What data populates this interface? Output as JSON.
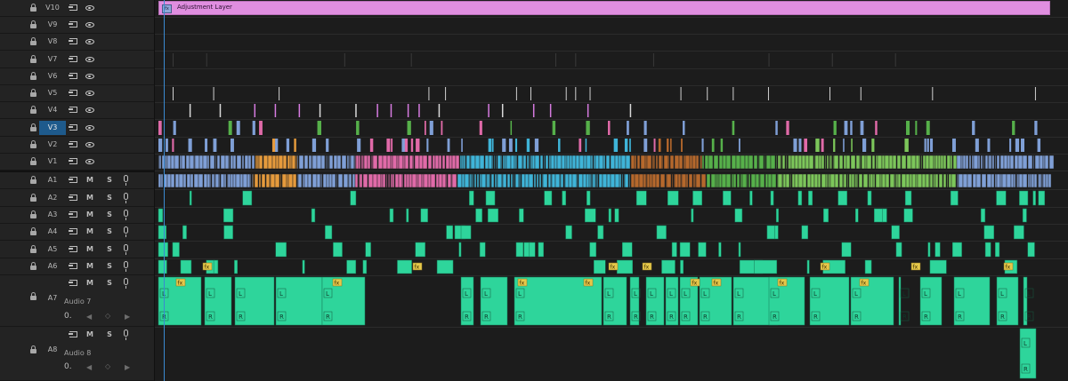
{
  "tracks": {
    "video": [
      {
        "name": "V10",
        "active": false
      },
      {
        "name": "V9",
        "active": false
      },
      {
        "name": "V8",
        "active": false
      },
      {
        "name": "V7",
        "active": false
      },
      {
        "name": "V6",
        "active": false
      },
      {
        "name": "V5",
        "active": false
      },
      {
        "name": "V4",
        "active": false
      },
      {
        "name": "V3",
        "active": true
      },
      {
        "name": "V2",
        "active": false
      },
      {
        "name": "V1",
        "active": false
      }
    ],
    "audio": [
      {
        "name": "A1",
        "m": "M",
        "s": "S"
      },
      {
        "name": "A2",
        "m": "M",
        "s": "S"
      },
      {
        "name": "A3",
        "m": "M",
        "s": "S"
      },
      {
        "name": "A4",
        "m": "M",
        "s": "S"
      },
      {
        "name": "A5",
        "m": "M",
        "s": "S"
      },
      {
        "name": "A6",
        "m": "M",
        "s": "S"
      },
      {
        "name": "A7",
        "m": "M",
        "s": "S",
        "label": "Audio 7",
        "volume": "0."
      },
      {
        "name": "A8",
        "m": "M",
        "s": "S",
        "label": "Audio 8",
        "volume": "0."
      }
    ]
  },
  "adjustment_layer": {
    "label": "Adjustment Layer",
    "fx": "fx"
  },
  "fx_badge": "fx",
  "channel_left": "L",
  "channel_right": "R",
  "colors": {
    "adjustment": "#e08ee0",
    "v1_blue": "#7f9fd6",
    "orange": "#e59a3c",
    "pink": "#e06aa8",
    "cyan": "#3fb4d8",
    "brown": "#b5682c",
    "green": "#56b04a",
    "lightgreen": "#7cc65a",
    "audio": "#2ed59b",
    "playhead": "#3a8ad1"
  },
  "icons": [
    "lock-icon",
    "sync-lock-icon",
    "eye-icon",
    "microphone-icon",
    "keyframe-prev-icon",
    "keyframe-add-icon",
    "keyframe-next-icon"
  ]
}
